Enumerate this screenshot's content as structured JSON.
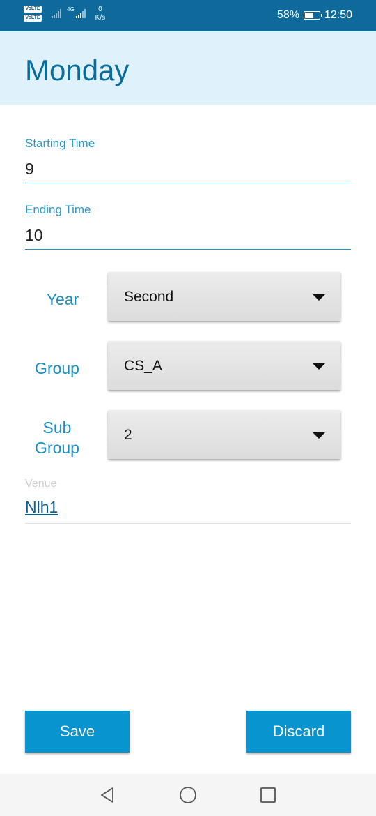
{
  "status_bar": {
    "volte_1": "VoLTE",
    "volte_2": "VoLTE",
    "network_type": "4G",
    "speed_value": "0",
    "speed_unit": "K/s",
    "battery_percent": "58%",
    "battery_level": 0.58,
    "time": "12:50"
  },
  "app_bar": {
    "title": "Monday"
  },
  "form": {
    "starting_time": {
      "label": "Starting Time",
      "value": "9"
    },
    "ending_time": {
      "label": "Ending Time",
      "value": "10"
    },
    "year": {
      "label": "Year",
      "value": "Second"
    },
    "group": {
      "label": "Group",
      "value": "CS_A"
    },
    "sub_group": {
      "label_line1": "Sub",
      "label_line2": "Group",
      "value": "2"
    },
    "venue": {
      "label": "Venue",
      "value": "Nlh1"
    }
  },
  "buttons": {
    "save": "Save",
    "discard": "Discard"
  },
  "colors": {
    "status_bar": "#0d6a9b",
    "app_bar_bg": "#dff2fb",
    "title": "#0b6c9c",
    "accent": "#0895cf"
  }
}
